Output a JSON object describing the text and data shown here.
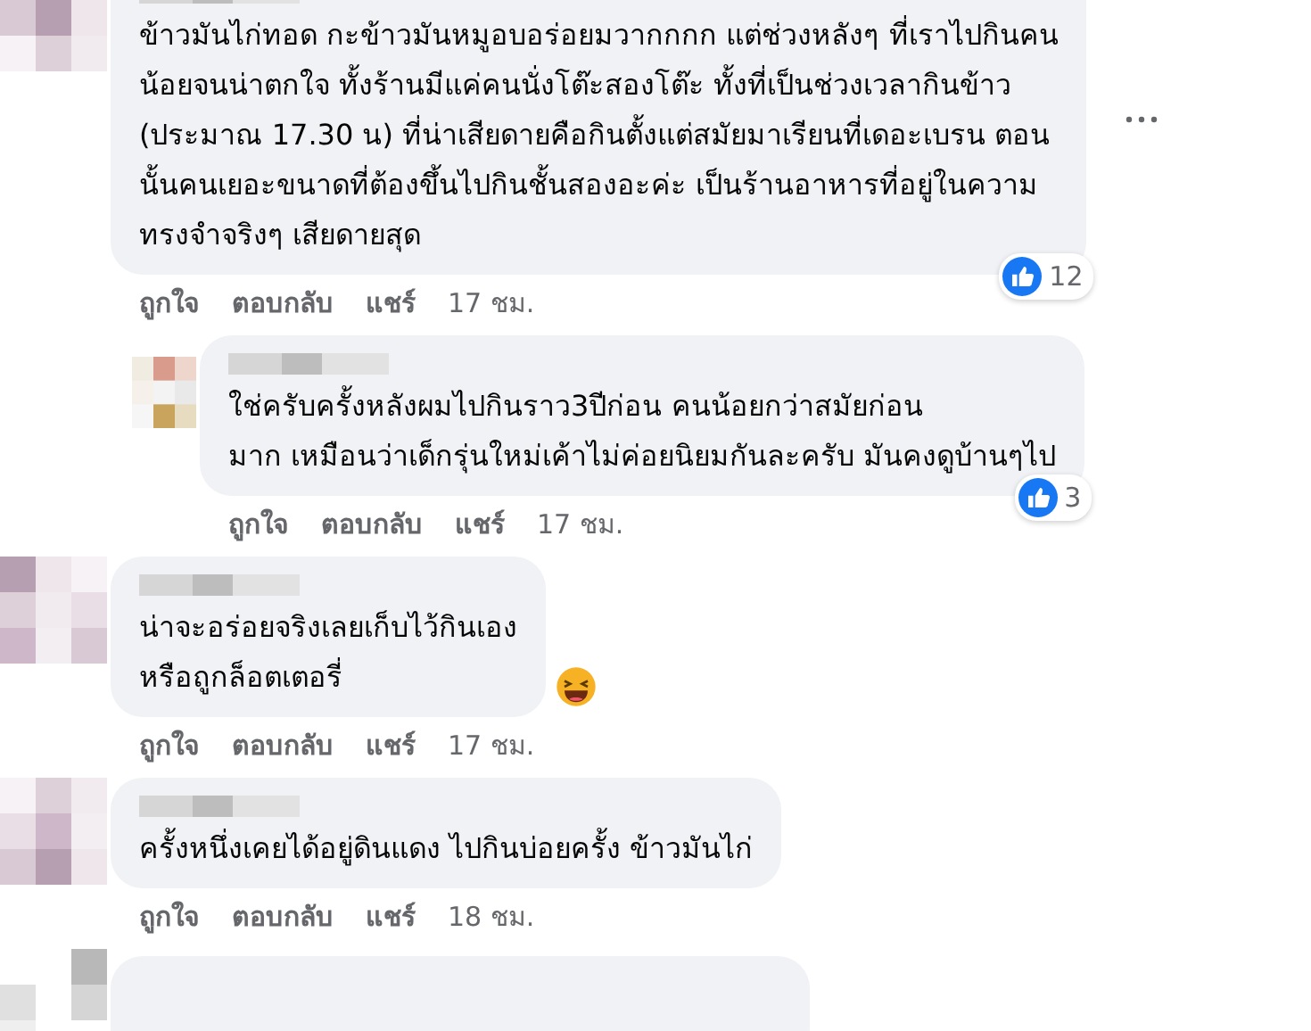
{
  "comments": [
    {
      "kind": "top",
      "lines": [
        "ข้าวมันไก่ทอด กะข้าวมันหมูอบอร่อยมวากกกก แต่ช่วงหลังๆ ที่เราไปกินคน",
        "น้อยจนน่าตกใจ ทั้งร้านมีแค่คนนั่งโต๊ะสองโต๊ะ ทั้งที่เป็นช่วงเวลากินข้าว",
        "(ประมาณ 17.30 น) ที่น่าเสียดายคือกินตั้งแต่สมัยมาเรียนที่เดอะเบรน ตอน",
        "นั้นคนเยอะขนาดที่ต้องขึ้นไปกินชั้นสองอะค่ะ เป็นร้านอาหารที่อยู่ในความ",
        "ทรงจำจริงๆ เสียดายสุด"
      ],
      "reaction": {
        "kind": "like",
        "count": "12"
      },
      "more": true,
      "actions": [
        "ถูกใจ",
        "ตอบกลับ",
        "แชร์",
        "17 ชม."
      ]
    },
    {
      "kind": "reply",
      "lines": [
        "ใช่ครับครั้งหลังผมไปกินราว3ปีก่อน คนน้อยกว่าสมัยก่อน",
        "มาก เหมือนว่าเด็กรุ่นใหม่เค้าไม่ค่อยนิยมกันละครับ มันคงดูบ้านๆไป"
      ],
      "reaction": {
        "kind": "like",
        "count": "3"
      },
      "more": false,
      "actions": [
        "ถูกใจ",
        "ตอบกลับ",
        "แชร์",
        "17 ชม."
      ]
    },
    {
      "kind": "top",
      "lines": [
        "น่าจะอร่อยจริงเลยเก็บไว้กินเอง",
        "หรือถูกล็อตเตอรี่"
      ],
      "reaction": {
        "kind": "haha"
      },
      "more": false,
      "actions": [
        "ถูกใจ",
        "ตอบกลับ",
        "แชร์",
        "17 ชม."
      ]
    },
    {
      "kind": "top",
      "lines": [
        "ครั้งหนึ่งเคยได้อยู่ดินแดง ไปกินบ่อยครั้ง ข้าวมันไก่"
      ],
      "more": false,
      "actions": [
        "ถูกใจ",
        "ตอบกลับ",
        "แชร์",
        "18 ชม."
      ]
    },
    {
      "kind": "stub",
      "more": false
    }
  ]
}
